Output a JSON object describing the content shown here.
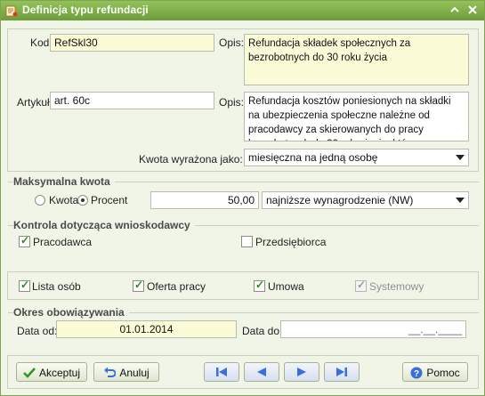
{
  "window": {
    "title": "Definicja typu refundacji",
    "colors": {
      "titlebar": "#7aaa45",
      "background": "#f1f5e8",
      "highlight_field": "#fbfbd7",
      "nav_arrows": "#3a6fd8"
    }
  },
  "form": {
    "kod_label": "Kod:",
    "kod_value": "RefSkl30",
    "opis1_label": "Opis:",
    "opis1_value": "Refundacja składek społecznych za bezrobotnych do 30 roku życia",
    "artykul_label": "Artykuł:",
    "artykul_value": "art. 60c",
    "opis2_label": "Opis:",
    "opis2_value": "Refundacja kosztów poniesionych na składki na ubezpieczenia społeczne należne od pracodawcy za skierowanych do pracy bezrobotnych do 30 roku życia, którzy podejmują zatrudnienie po raz pierwszy w życiu.",
    "kwota_label": "Kwota wyrażona jako:",
    "kwota_value": "miesięczna na jedną osobę"
  },
  "max_amount": {
    "title": "Maksymalna kwota",
    "kwota_radio": "Kwota",
    "procent_radio": "Procent",
    "selected": "Procent",
    "value": "50,00",
    "base_value": "najniższe wynagrodzenie (NW)"
  },
  "applicant": {
    "title": "Kontrola dotycząca wnioskodawcy",
    "pracodawca": {
      "label": "Pracodawca",
      "checked": true
    },
    "przedsiebiorca": {
      "label": "Przedsiębiorca",
      "checked": false
    }
  },
  "options": {
    "lista_osob": {
      "label": "Lista osób",
      "checked": true
    },
    "oferta_pracy": {
      "label": "Oferta pracy",
      "checked": true
    },
    "umowa": {
      "label": "Umowa",
      "checked": true
    },
    "systemowy": {
      "label": "Systemowy",
      "checked": true,
      "disabled": true
    }
  },
  "validity": {
    "title": "Okres obowiązywania",
    "from_label": "Data od:",
    "from_value": "01.01.2014",
    "to_label": "Data do:",
    "to_value": "__.__.____"
  },
  "footer": {
    "accept": "Akceptuj",
    "cancel": "Anuluj",
    "help": "Pomoc"
  },
  "icons": [
    "app-icon",
    "minimize-icon",
    "close-icon",
    "check-icon",
    "undo-icon",
    "first-icon",
    "prev-icon",
    "next-icon",
    "last-icon",
    "help-icon",
    "dropdown-arrow-icon"
  ]
}
